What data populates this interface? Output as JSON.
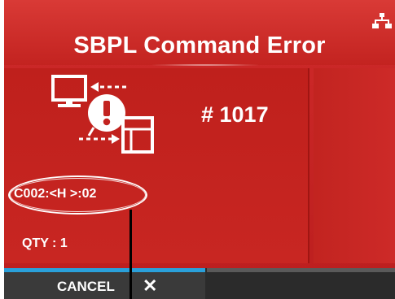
{
  "header": {
    "title": "SBPL Command Error"
  },
  "status": {
    "network_icon": "network-icon"
  },
  "error": {
    "code": "# 1017",
    "command": "C002:<H >:02",
    "qty": "QTY : 1"
  },
  "footer": {
    "cancel_label": "CANCEL",
    "cancel_icon": "✕"
  },
  "colors": {
    "background_red": "#c32320",
    "accent_blue": "#2aa0da",
    "footer": "#2b2b2b"
  }
}
